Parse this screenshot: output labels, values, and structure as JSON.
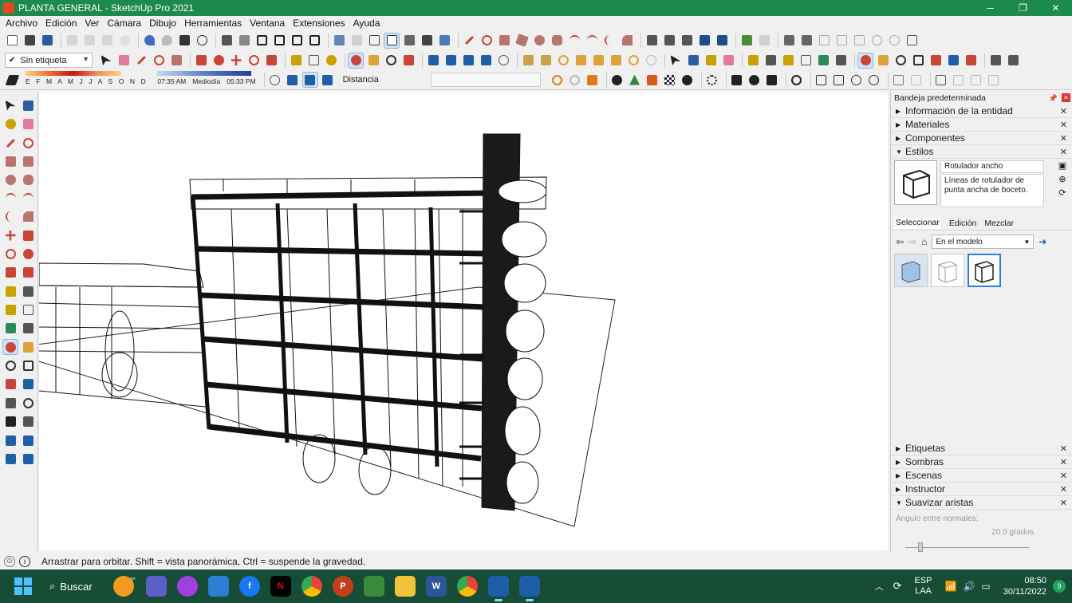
{
  "window": {
    "title": "PLANTA GENERAL - SketchUp Pro 2021",
    "controls": [
      "─",
      "❐",
      "✕"
    ]
  },
  "menu": [
    "Archivo",
    "Edición",
    "Ver",
    "Cámara",
    "Dibujo",
    "Herramientas",
    "Ventana",
    "Extensiones",
    "Ayuda"
  ],
  "toolbar": {
    "tag_value": "Sin etiqueta",
    "shadow_months": "E F M A M J J A S O N D",
    "time_start": "07:35 AM",
    "time_mid": "Mediodía",
    "time_end": "05:33 PM",
    "measure_label": "Distancia",
    "measure_value": ""
  },
  "tray": {
    "title": "Bandeja predeterminada",
    "panels_top": [
      {
        "label": "Información de la entidad",
        "expanded": false
      },
      {
        "label": "Materiales",
        "expanded": false
      },
      {
        "label": "Componentes",
        "expanded": false
      },
      {
        "label": "Estilos",
        "expanded": true
      }
    ],
    "style": {
      "name": "Rotulador ancho",
      "description": "Líneas de rotulador de punta ancha de boceto.",
      "tabs": [
        "Seleccionar",
        "Edición",
        "Mezclar"
      ],
      "active_tab": "Seleccionar",
      "collection": "En el modelo"
    },
    "panels_bottom": [
      {
        "label": "Etiquetas",
        "expanded": false
      },
      {
        "label": "Sombras",
        "expanded": false
      },
      {
        "label": "Escenas",
        "expanded": false
      },
      {
        "label": "Instructor",
        "expanded": false
      },
      {
        "label": "Suavizar aristas",
        "expanded": true
      }
    ],
    "soften": {
      "angle_label": "Ángulo entre normales:",
      "angle_value": "20.0 grados",
      "slider_fraction": 0.12
    }
  },
  "status": {
    "message": "Arrastrar para orbitar. Shift = vista panorámica, Ctrl = suspende la gravedad."
  },
  "taskbar": {
    "search_label": "Buscar",
    "badge_18": "18°",
    "language_top": "ESP",
    "language_bottom": "LAA",
    "time": "08:50",
    "date": "30/11/2022",
    "notifications": "9",
    "colors": {
      "background": "#174c36",
      "accent": "#4cc2ff"
    },
    "apps": [
      "weather",
      "chat",
      "messenger",
      "notepad",
      "facebook",
      "netflix",
      "chrome",
      "powerpoint",
      "files-stack",
      "explorer",
      "word",
      "chrome-alt",
      "sketchup-active",
      "sketchup-2"
    ]
  },
  "colors": {
    "titlebar": "#1c8a4a",
    "selection": "#2a7fd5",
    "close": "#e03030"
  }
}
